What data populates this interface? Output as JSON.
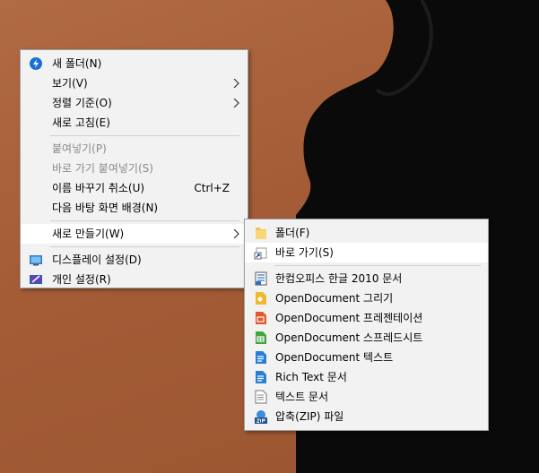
{
  "context_menu": {
    "items": [
      {
        "label": "새 폴더(N)",
        "icon": "new-folder-icon"
      },
      {
        "label": "보기(V)"
      },
      {
        "label": "정렬 기준(O)"
      },
      {
        "label": "새로 고침(E)"
      },
      {
        "label": "붙여넣기(P)",
        "disabled": true
      },
      {
        "label": "바로 가기 붙여넣기(S)",
        "disabled": true
      },
      {
        "label": "이름 바꾸기 취소(U)",
        "shortcut": "Ctrl+Z"
      },
      {
        "label": "다음 바탕 화면 배경(N)"
      },
      {
        "label": "새로 만들기(W)"
      },
      {
        "label": "디스플레이 설정(D)",
        "icon": "display-settings-icon"
      },
      {
        "label": "개인 설정(R)",
        "icon": "personalize-icon"
      }
    ]
  },
  "new_submenu": {
    "items": [
      {
        "label": "폴더(F)",
        "icon": "folder-icon"
      },
      {
        "label": "바로 가기(S)",
        "icon": "shortcut-icon"
      },
      {
        "label": "한컴오피스 한글 2010 문서",
        "icon": "hwp-document-icon"
      },
      {
        "label": "OpenDocument 그리기",
        "icon": "odg-icon"
      },
      {
        "label": "OpenDocument 프레젠테이션",
        "icon": "odp-icon"
      },
      {
        "label": "OpenDocument 스프레드시트",
        "icon": "ods-icon"
      },
      {
        "label": "OpenDocument 텍스트",
        "icon": "odt-icon"
      },
      {
        "label": "Rich Text 문서",
        "icon": "rtf-document-icon"
      },
      {
        "label": "텍스트 문서",
        "icon": "text-document-icon"
      },
      {
        "label": "압축(ZIP) 파일",
        "icon": "zip-folder-icon"
      }
    ]
  },
  "colors": {
    "desktop_bg": "#a55e38",
    "menu_bg": "#f2f2f2",
    "highlight": "#ffffff",
    "disabled_text": "#8a8a8a"
  }
}
